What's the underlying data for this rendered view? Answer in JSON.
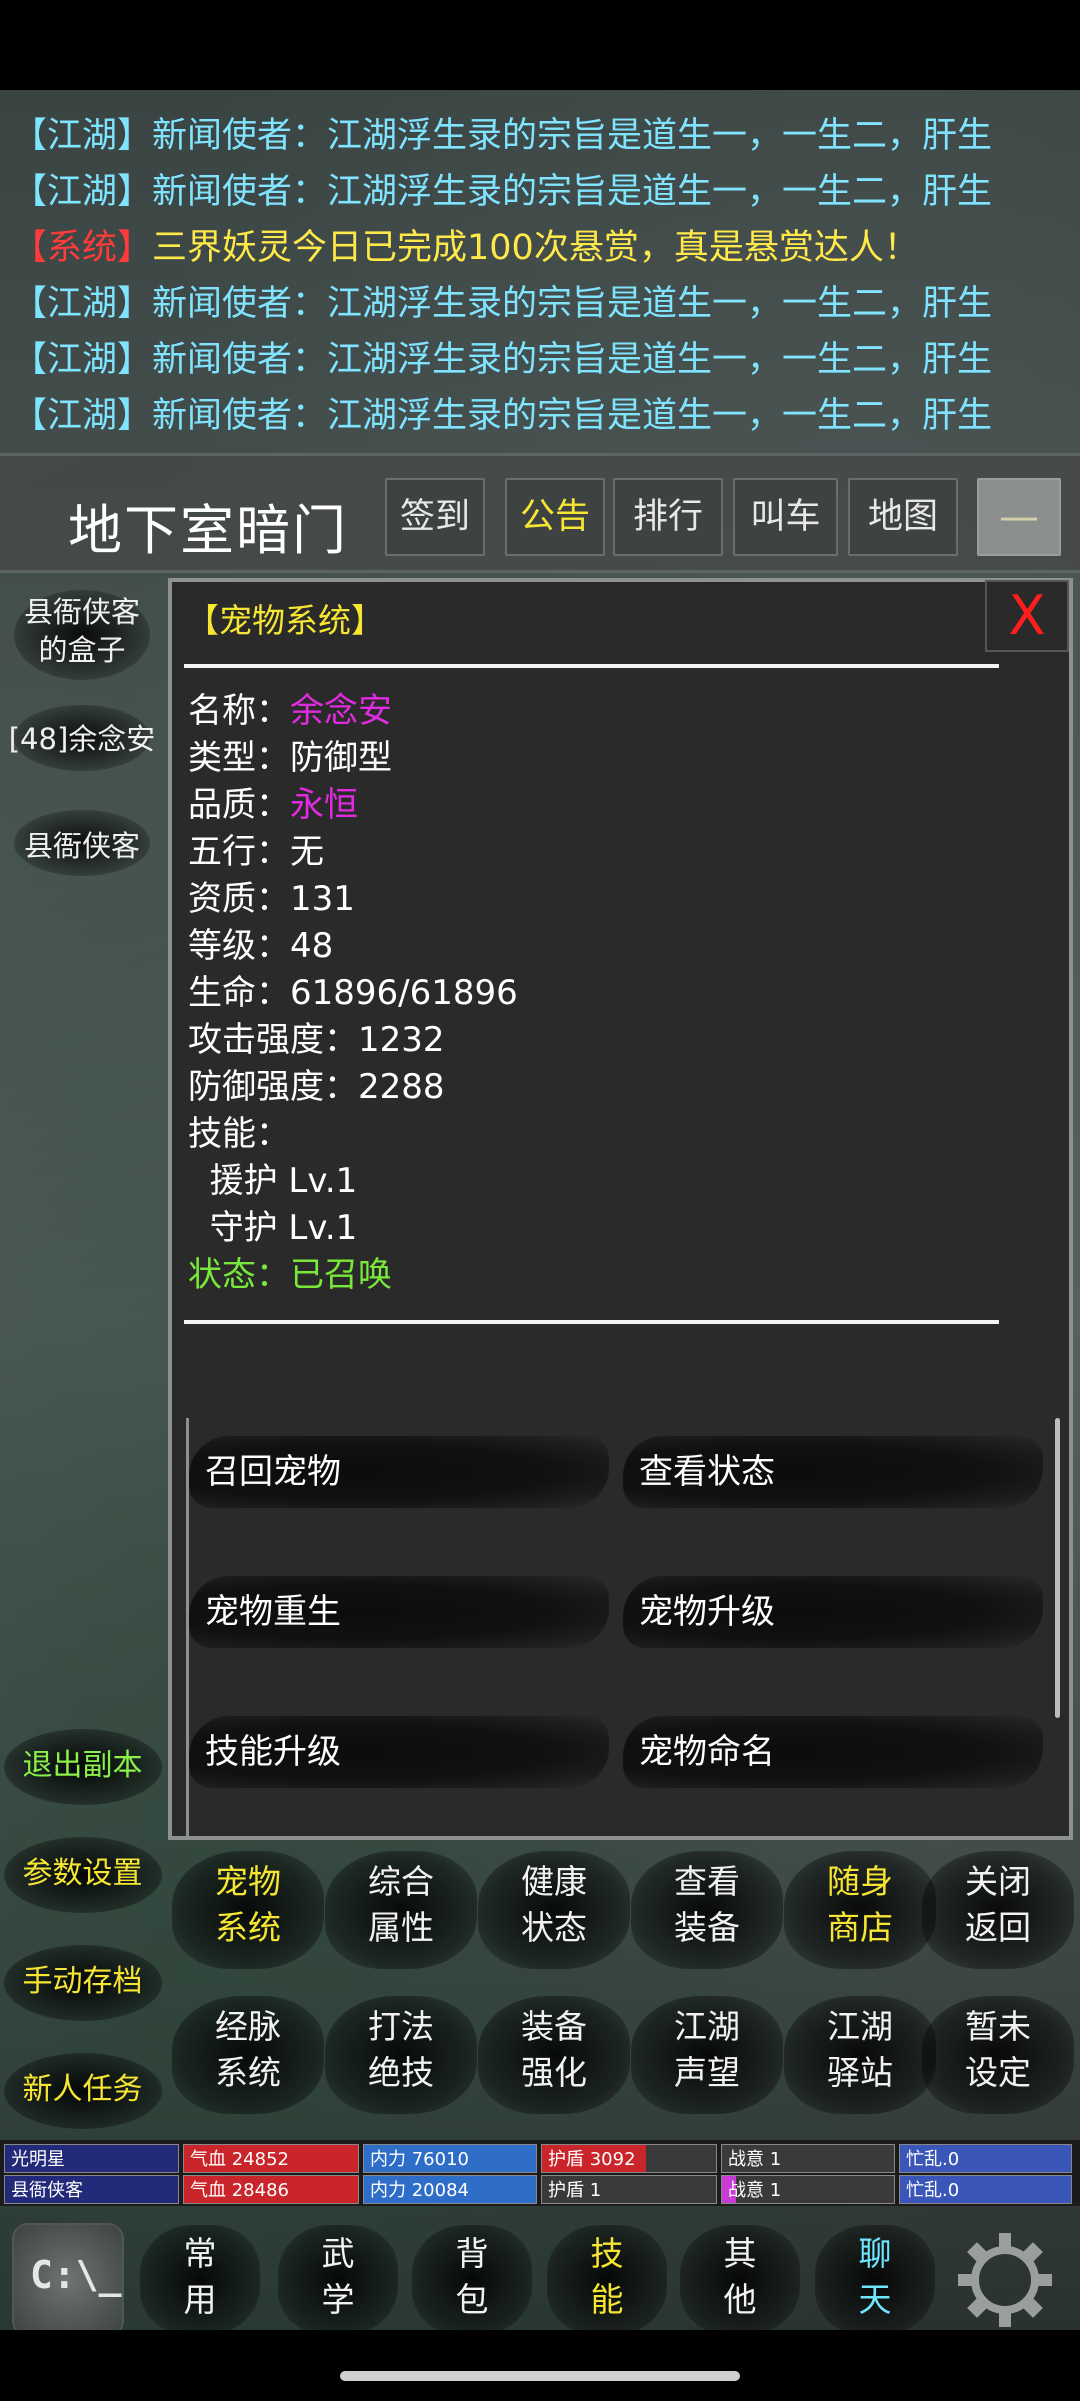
{
  "chat": [
    {
      "tag": "【江湖】",
      "msg": "新闻使者：江湖浮生录的宗旨是道生一，一生二，肝生",
      "type": "jianghu"
    },
    {
      "tag": "【江湖】",
      "msg": "新闻使者：江湖浮生录的宗旨是道生一，一生二，肝生",
      "type": "jianghu"
    },
    {
      "tag": "【系统】",
      "msg": "三界妖灵今日已完成100次悬赏，真是悬赏达人！",
      "type": "sys"
    },
    {
      "tag": "【江湖】",
      "msg": "新闻使者：江湖浮生录的宗旨是道生一，一生二，肝生",
      "type": "jianghu"
    },
    {
      "tag": "【江湖】",
      "msg": "新闻使者：江湖浮生录的宗旨是道生一，一生二，肝生",
      "type": "jianghu"
    },
    {
      "tag": "【江湖】",
      "msg": "新闻使者：江湖浮生录的宗旨是道生一，一生二，肝生",
      "type": "jianghu"
    }
  ],
  "header": {
    "location": "地下室暗门",
    "buttons": [
      "签到",
      "公告",
      "排行",
      "叫车",
      "地图"
    ],
    "menu_glyph": "—"
  },
  "npcs": [
    "县衙侠客的盒子",
    "[48]余念安",
    "县衙侠客"
  ],
  "side_buttons": [
    "退出副本",
    "参数设置",
    "手动存档",
    "新人任务"
  ],
  "panel": {
    "title": "【宠物系统】",
    "close": "X",
    "rows": [
      {
        "label": "名称：",
        "value": "余念安"
      },
      {
        "label": "类型：",
        "value": "防御型"
      },
      {
        "label": "品质：",
        "value": "永恒"
      },
      {
        "label": "五行：",
        "value": "无"
      },
      {
        "label": "资质：",
        "value": "131"
      },
      {
        "label": "等级：",
        "value": "48"
      },
      {
        "label": "生命：",
        "value": "61896/61896"
      },
      {
        "label": "攻击强度：",
        "value": "1232"
      },
      {
        "label": "防御强度：",
        "value": "2288"
      },
      {
        "label": "技能：",
        "value": ""
      },
      {
        "label": "  援护 Lv.1",
        "value": ""
      },
      {
        "label": "  守护 Lv.1",
        "value": ""
      },
      {
        "label": "状态：",
        "value": "已召唤"
      }
    ],
    "actions": [
      "召回宠物",
      "查看状态",
      "宠物重生",
      "宠物升级",
      "技能升级",
      "宠物命名"
    ]
  },
  "grid": [
    {
      "l1": "宠物",
      "l2": "系统",
      "hl": true
    },
    {
      "l1": "综合",
      "l2": "属性",
      "hl": false
    },
    {
      "l1": "健康",
      "l2": "状态",
      "hl": false
    },
    {
      "l1": "查看",
      "l2": "装备",
      "hl": false
    },
    {
      "l1": "随身",
      "l2": "商店",
      "hl": true
    },
    {
      "l1": "关闭",
      "l2": "返回",
      "hl": false
    },
    {
      "l1": "经脉",
      "l2": "系统",
      "hl": false
    },
    {
      "l1": "打法",
      "l2": "绝技",
      "hl": false
    },
    {
      "l1": "装备",
      "l2": "强化",
      "hl": false
    },
    {
      "l1": "江湖",
      "l2": "声望",
      "hl": false
    },
    {
      "l1": "江湖",
      "l2": "驿站",
      "hl": false
    },
    {
      "l1": "暂未",
      "l2": "设定",
      "hl": false
    }
  ],
  "stats": [
    [
      {
        "text": "光明星",
        "fill": 1.0,
        "color": "#232a7a"
      },
      {
        "text": "气血 24852",
        "fill": 1.0,
        "color": "#c9252b"
      },
      {
        "text": "内力 76010",
        "fill": 1.0,
        "color": "#2f6ec8"
      },
      {
        "text": "护盾 3092",
        "fill": 0.6,
        "color": "#c9252b"
      },
      {
        "text": "战意 1",
        "fill": 0.0,
        "color": "#c93ad6"
      },
      {
        "text": "忙乱.0",
        "fill": 1.0,
        "color": "#3a56b8"
      }
    ],
    [
      {
        "text": "县衙侠客",
        "fill": 1.0,
        "color": "#232a7a"
      },
      {
        "text": "气血 28486",
        "fill": 1.0,
        "color": "#c9252b"
      },
      {
        "text": "内力 20084",
        "fill": 1.0,
        "color": "#2f6ec8"
      },
      {
        "text": "护盾 1",
        "fill": 0.0,
        "color": "#c9252b"
      },
      {
        "text": "战意 1",
        "fill": 0.08,
        "color": "#c93ad6"
      },
      {
        "text": "忙乱.0",
        "fill": 1.0,
        "color": "#3a56b8"
      }
    ]
  ],
  "tabs": [
    {
      "l1": "常",
      "l2": "用",
      "color": "white"
    },
    {
      "l1": "武",
      "l2": "学",
      "color": "white"
    },
    {
      "l1": "背",
      "l2": "包",
      "color": "white"
    },
    {
      "l1": "技",
      "l2": "能",
      "color": "yellow"
    },
    {
      "l1": "其",
      "l2": "他",
      "color": "white"
    },
    {
      "l1": "聊",
      "l2": "天",
      "color": "cyan"
    }
  ],
  "console_label": "C:\\_"
}
